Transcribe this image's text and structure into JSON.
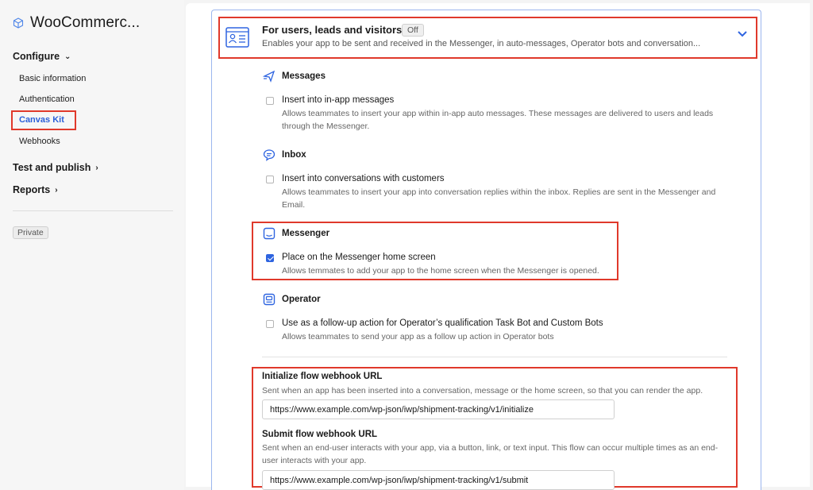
{
  "sidebar": {
    "app_title": "WooCommerc...",
    "configure_label": "Configure",
    "configure_items": [
      {
        "label": "Basic information",
        "active": false
      },
      {
        "label": "Authentication",
        "active": false
      },
      {
        "label": "Canvas Kit",
        "active": true
      },
      {
        "label": "Webhooks",
        "active": false
      }
    ],
    "test_publish_label": "Test and publish",
    "reports_label": "Reports",
    "visibility_badge": "Private"
  },
  "section": {
    "title": "For users, leads and visitors",
    "status_badge": "Off",
    "description": "Enables your app to be sent and received in the Messenger, in auto-messages, Operator bots and conversation..."
  },
  "groups": [
    {
      "title": "Messages",
      "icon": "paper-plane-icon",
      "option_label": "Insert into in-app messages",
      "option_desc": "Allows teammates to insert your app within in-app auto messages. These messages are delivered to users and leads through the Messenger.",
      "checked": false
    },
    {
      "title": "Inbox",
      "icon": "chat-bubble-icon",
      "option_label": "Insert into conversations with customers",
      "option_desc": "Allows teammates to insert your app into conversation replies within the inbox. Replies are sent in the Messenger and Email.",
      "checked": false
    },
    {
      "title": "Messenger",
      "icon": "messenger-icon",
      "option_label": "Place on the Messenger home screen",
      "option_desc": "Allows temmates to add your app to the home screen when the Messenger is opened.",
      "checked": true
    },
    {
      "title": "Operator",
      "icon": "operator-icon",
      "option_label": "Use as a follow-up action for Operator’s qualification Task Bot and Custom Bots",
      "option_desc": "Allows teammates to send your app as a follow up action in Operator bots",
      "checked": false
    }
  ],
  "webhooks": {
    "initialize": {
      "title": "Initialize flow webhook URL",
      "desc": "Sent when an app has been inserted into a conversation, message or the home screen, so that you can render the app.",
      "value": "https://www.example.com/wp-json/iwp/shipment-tracking/v1/initialize"
    },
    "submit": {
      "title": "Submit flow webhook URL",
      "desc": "Sent when an end-user interacts with your app, via a button, link, or text input. This flow can occur multiple times as an end-user interacts with your app.",
      "value": "https://www.example.com/wp-json/iwp/shipment-tracking/v1/submit"
    }
  },
  "colors": {
    "accent": "#2e64e0",
    "active_nav": "#2b5fd9",
    "highlight_border": "#e0392b"
  }
}
